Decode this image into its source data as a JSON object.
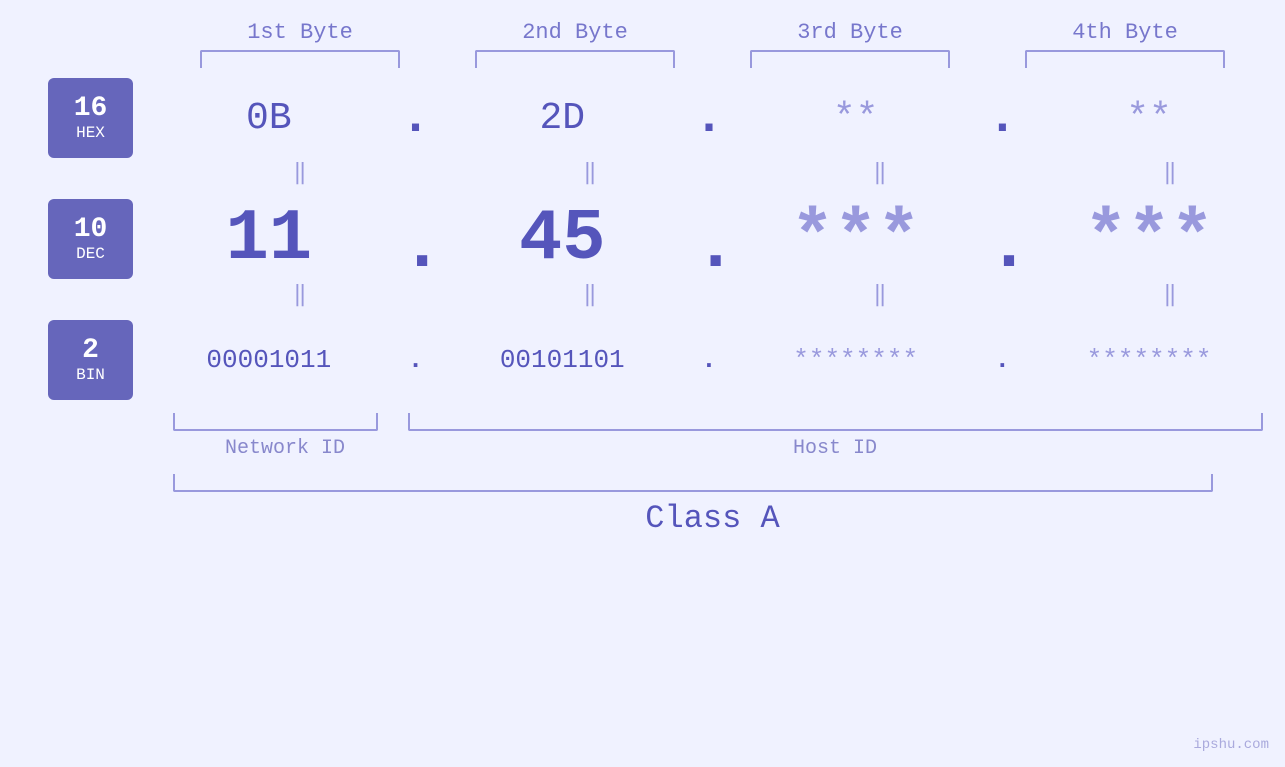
{
  "page": {
    "background": "#f0f2ff",
    "watermark": "ipshu.com"
  },
  "header": {
    "byte1": "1st Byte",
    "byte2": "2nd Byte",
    "byte3": "3rd Byte",
    "byte4": "4th Byte"
  },
  "badges": {
    "hex": {
      "number": "16",
      "label": "HEX"
    },
    "dec": {
      "number": "10",
      "label": "DEC"
    },
    "bin": {
      "number": "2",
      "label": "BIN"
    }
  },
  "hex_row": {
    "b1": "0B",
    "b2": "2D",
    "b3": "**",
    "b4": "**",
    "dot": "."
  },
  "dec_row": {
    "b1": "11",
    "b2": "45",
    "b3": "***",
    "b4": "***",
    "dot": "."
  },
  "bin_row": {
    "b1": "00001011",
    "b2": "00101101",
    "b3": "********",
    "b4": "********",
    "dot": "."
  },
  "labels": {
    "network_id": "Network ID",
    "host_id": "Host ID",
    "class": "Class A"
  }
}
